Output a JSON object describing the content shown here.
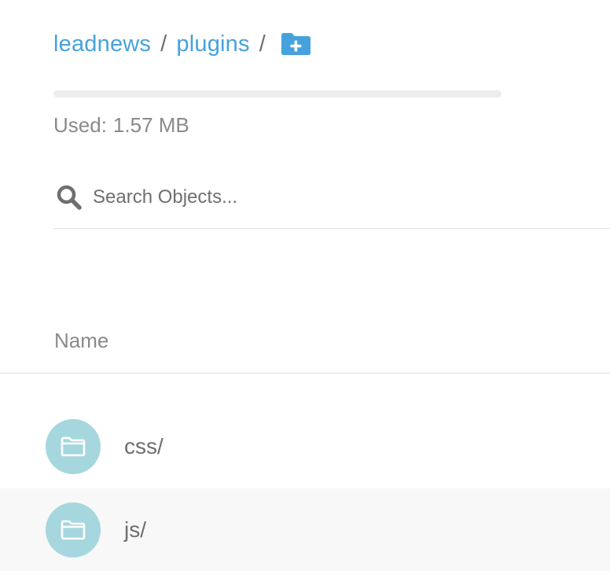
{
  "breadcrumb": {
    "items": [
      "leadnews",
      "plugins"
    ],
    "separator": "/",
    "new_folder_icon": "folder-plus-icon"
  },
  "usage": {
    "label": "Used:",
    "value": "1.57 MB",
    "fill_fraction": 0
  },
  "search": {
    "icon": "search-icon",
    "placeholder": "Search Objects...",
    "value": ""
  },
  "table": {
    "columns": [
      "Name"
    ],
    "rows": [
      {
        "name": "css/",
        "icon": "folder-icon"
      },
      {
        "name": "js/",
        "icon": "folder-icon"
      }
    ]
  },
  "colors": {
    "accent": "#46a2dc",
    "folder_avatar": "#a6d7de",
    "text_muted": "#8a8a8a",
    "row_alt": "#f8f8f8"
  }
}
